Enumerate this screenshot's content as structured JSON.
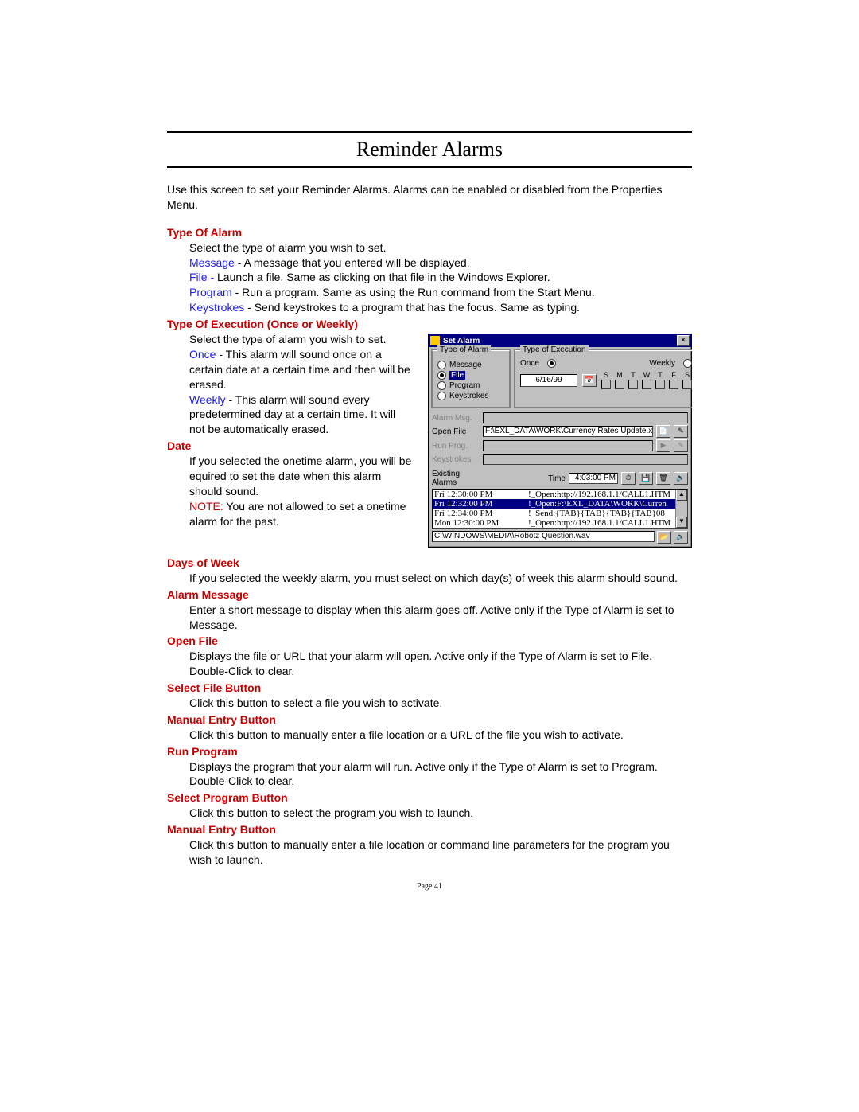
{
  "title": "Reminder Alarms",
  "intro": "Use this screen to set your Reminder Alarms.  Alarms can be enabled or disabled from the Properties Menu.",
  "footer": "Page 41",
  "sections": {
    "typeOfAlarm": {
      "head": "Type Of Alarm",
      "line1": "Select the type of alarm you wish to set.",
      "msg_lbl": "Message",
      "msg_txt": " - A message that you entered will be displayed.",
      "file_lbl": "File",
      "file_dash": " - ",
      "file_txt": "Launch a file.  Same as clicking on that file in the Windows Explorer.",
      "prog_lbl": "Program",
      "prog_txt": " - Run a program. Same as using the Run command from the Start Menu.",
      "keys_lbl": "Keystrokes",
      "keys_txt": " - Send keystrokes to a program that has the focus.  Same as typing."
    },
    "execType": {
      "head": "Type Of Execution (Once or Weekly)",
      "line1": "Select the type of alarm you wish to set.",
      "once_lbl": "Once",
      "once_txt": " - This alarm will sound once on a certain date at a certain time and then will be erased.",
      "weekly_lbl": "Weekly",
      "weekly_txt": " - This alarm will sound every predetermined day at a certain time.  It will not be automatically erased."
    },
    "date": {
      "head": "Date",
      "line1": "If you selected the onetime alarm, you will be equired to set the date when this alarm should sound.",
      "note_lbl": "NOTE:",
      "note_txt": "  You are not allowed to set a onetime alarm for the past."
    },
    "dow": {
      "head": "Days of Week",
      "txt": "If you selected the weekly alarm, you must select on which day(s) of week this alarm should sound."
    },
    "alarmMsg": {
      "head": "Alarm Message",
      "txt": "Enter a short message to display when this alarm goes off.  Active only if the Type of Alarm is set to Message."
    },
    "openFile": {
      "head": "Open File",
      "txt": "Displays the file or URL that your alarm will open.  Active only if the Type of Alarm is set to File.  Double-Click to clear."
    },
    "selFile": {
      "head": "Select File Button",
      "txt": "Click this button to select a file you wish to activate."
    },
    "manEntry1": {
      "head": "Manual Entry Button",
      "txt": "Click this button to manually enter a file location or a URL of the file you wish to activate."
    },
    "runProg": {
      "head": "Run Program",
      "txt": "Displays the program that your alarm will run.  Active only if the Type of Alarm is set to Program.  Double-Click to clear."
    },
    "selProg": {
      "head": "Select Program Button",
      "txt": "Click this button to select the program you wish to launch."
    },
    "manEntry2": {
      "head": "Manual Entry Button",
      "txt": "Click this button to manually enter a file location or command line parameters for the program you wish to launch."
    }
  },
  "dialog": {
    "title": "Set Alarm",
    "group_type": "Type of Alarm",
    "group_exec": "Type of Execution",
    "radios": [
      "Message",
      "File",
      "Program",
      "Keystrokes"
    ],
    "exec_once": "Once",
    "exec_weekly": "Weekly",
    "date_value": "6/16/99",
    "days": [
      "S",
      "M",
      "T",
      "W",
      "T",
      "F",
      "S"
    ],
    "labels": {
      "alarm_msg": "Alarm Msg.",
      "open_file": "Open File",
      "run_prog": "Run Prog.",
      "keystrokes": "Keystrokes",
      "existing": "Existing Alarms",
      "time": "Time"
    },
    "open_file_value": "F:\\EXL_DATA\\WORK\\Currency Rates Update.xls",
    "time_value": "4:03:00 PM",
    "sound_path": "C:\\WINDOWS\\MEDIA\\Robotz Question.wav",
    "list": [
      {
        "time": "Fri 12:30:00 PM",
        "cmd": "!_Open:http://192.168.1.1/CALL1.HTM"
      },
      {
        "time": "Fri 12:32:00 PM",
        "cmd": "!_Open:F:\\EXL_DATA\\WORK\\Curren"
      },
      {
        "time": "Fri 12:34:00 PM",
        "cmd": "!_Send:{TAB}{TAB}{TAB}{TAB}08"
      },
      {
        "time": "Mon 12:30:00 PM",
        "cmd": "!_Open:http://192.168.1.1/CALL1.HTM"
      }
    ]
  }
}
